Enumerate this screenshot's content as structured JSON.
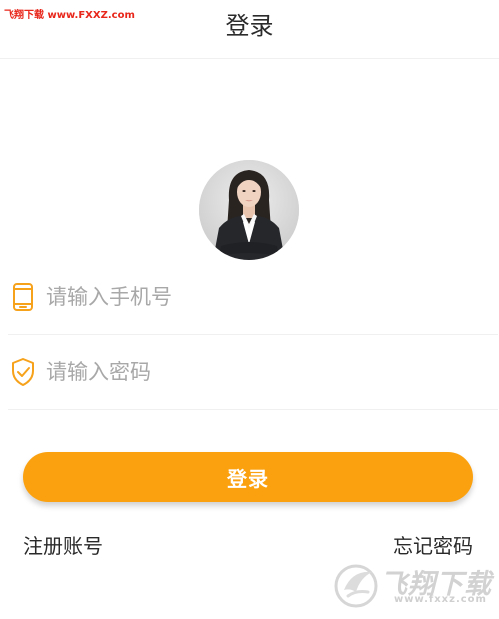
{
  "watermark": {
    "top_text": "飞翔下载 www.FXXZ.com",
    "logo_text": "飞翔下载",
    "logo_sub": "www.fxxz.com"
  },
  "header": {
    "title": "登录"
  },
  "avatar": {
    "icon": "user-avatar-photo"
  },
  "form": {
    "phone": {
      "icon": "phone-icon",
      "placeholder": "请输入手机号",
      "value": ""
    },
    "password": {
      "icon": "shield-check-icon",
      "placeholder": "请输入密码",
      "value": ""
    },
    "login_label": "登录"
  },
  "links": {
    "register": "注册账号",
    "forgot": "忘记密码"
  },
  "colors": {
    "accent": "#fba10f",
    "icon": "#f7a21b"
  }
}
